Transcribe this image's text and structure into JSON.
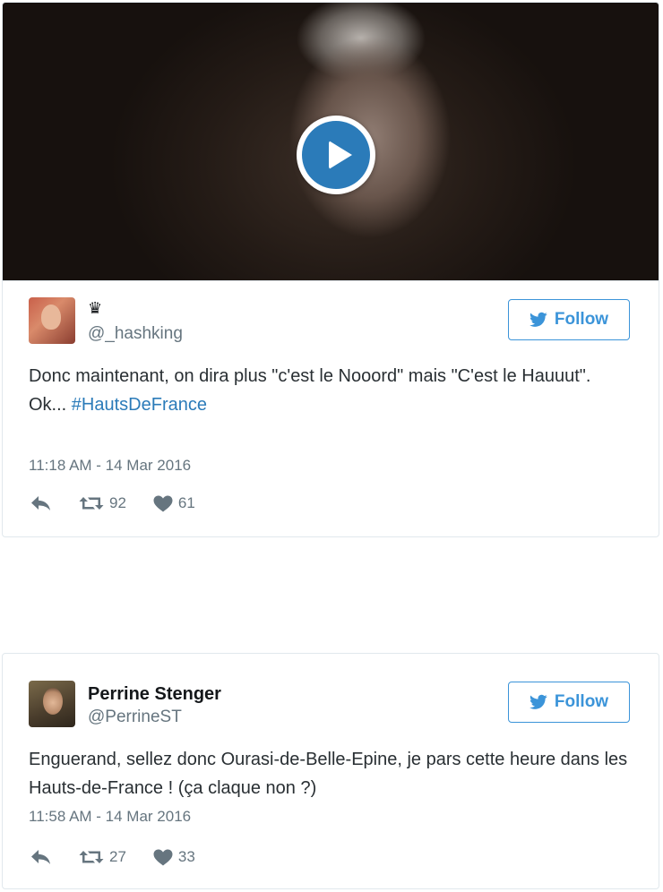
{
  "tweets": [
    {
      "display_name": "♛",
      "handle": "@_hashking",
      "follow_label": "Follow",
      "text_line1": "Donc maintenant, on dira plus \"c'est le Nooord\" mais \"C'est le Hauuut\".",
      "text_ok": "Ok... ",
      "hashtag": "#HautsDeFrance",
      "timestamp": "11:18 AM - 14 Mar 2016",
      "retweets": "92",
      "likes": "61",
      "has_video": true
    },
    {
      "display_name": "Perrine Stenger",
      "handle": "@PerrineST",
      "follow_label": "Follow",
      "text": "Enguerand, sellez donc Ourasi-de-Belle-Epine, je pars cette heure dans les Hauts-de-France ! (ça claque non ?)",
      "timestamp": "11:58 AM - 14 Mar 2016",
      "retweets": "27",
      "likes": "33"
    }
  ],
  "icons": {
    "play": "play-icon",
    "follow": "twitter-bird-icon",
    "reply": "reply-icon",
    "retweet": "retweet-icon",
    "like": "heart-icon"
  },
  "colors": {
    "accent": "#3b94d9",
    "link": "#2b7bb9",
    "muted": "#66757f",
    "text": "#292f33",
    "border": "#e1e8ed"
  }
}
